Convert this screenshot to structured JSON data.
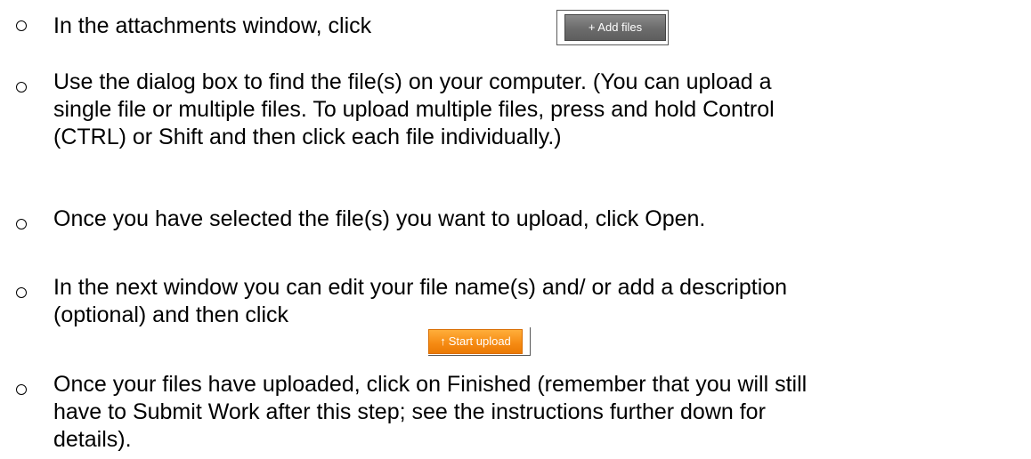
{
  "instructions": [
    {
      "lines": [
        "In the attachments window, click"
      ]
    },
    {
      "lines": [
        "Use the dialog box to find the file(s) on your computer. (You can upload a",
        "single file or multiple files. To upload multiple files, press and hold Control",
        "(CTRL) or Shift and then click each file individually.)"
      ]
    },
    {
      "lines": [
        "Once you have selected the file(s) you want to upload, click Open."
      ]
    },
    {
      "lines": [
        "In the next window you can edit your file name(s) and/ or add a description",
        "(optional) and then click"
      ]
    },
    {
      "lines": [
        "Once your files have uploaded, click on Finished (remember that you will still",
        "have to Submit Work after this step; see the instructions further down for",
        "details)."
      ]
    }
  ],
  "buttons": {
    "add_files_label": "+ Add files",
    "start_upload_arrow": "↑",
    "start_upload_label": "Start upload"
  },
  "colors": {
    "add_files_button": "#6b6b6b",
    "start_upload_button": "#f58a12"
  }
}
